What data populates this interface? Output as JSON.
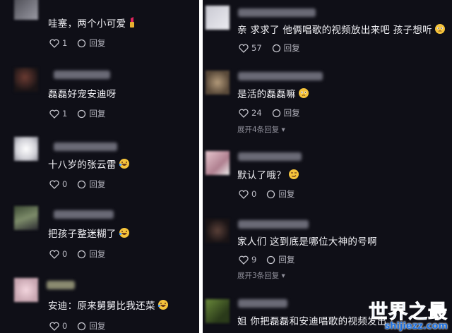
{
  "left_comments": [
    {
      "text": "哇塞，两个小可爱",
      "likes": "1",
      "reply": "回复",
      "emoji": "lipstick"
    },
    {
      "text": "磊磊好宠安迪呀",
      "likes": "1",
      "reply": "回复"
    },
    {
      "text": "十八岁的张云雷",
      "likes": "0",
      "reply": "回复",
      "emoji": "laugh"
    },
    {
      "text": "把孩子整迷糊了",
      "likes": "0",
      "reply": "回复",
      "emoji": "laugh"
    },
    {
      "text": "安迪：原来舅舅比我还菜",
      "likes": "0",
      "reply": "回复",
      "emoji": "laugh"
    }
  ],
  "right_comments": [
    {
      "text": "亲 求求了 他俩唱歌的视频放出来吧 孩子想听",
      "likes": "57",
      "reply": "回复",
      "emoji": "worried"
    },
    {
      "text": "是活的磊磊嘛",
      "likes": "24",
      "reply": "回复",
      "emoji": "worried",
      "expand": "展开4条回复"
    },
    {
      "text": "默认了哦？",
      "likes": "0",
      "reply": "回复",
      "emoji": "smug"
    },
    {
      "text": "家人们 这到底是哪位大神的号啊",
      "likes": "9",
      "reply": "回复",
      "expand": "展开3条回复"
    },
    {
      "text": "姐 你把磊磊和安迪唱歌的视频发出",
      "likes": "",
      "reply": ""
    }
  ],
  "watermark": {
    "main": "世界之最",
    "sub": "shijiezz.com"
  },
  "colors": {
    "background": "#0f0f17",
    "text": "#f2f2f6",
    "muted": "#b9b9c3",
    "watermark": "#1b6fe0"
  }
}
